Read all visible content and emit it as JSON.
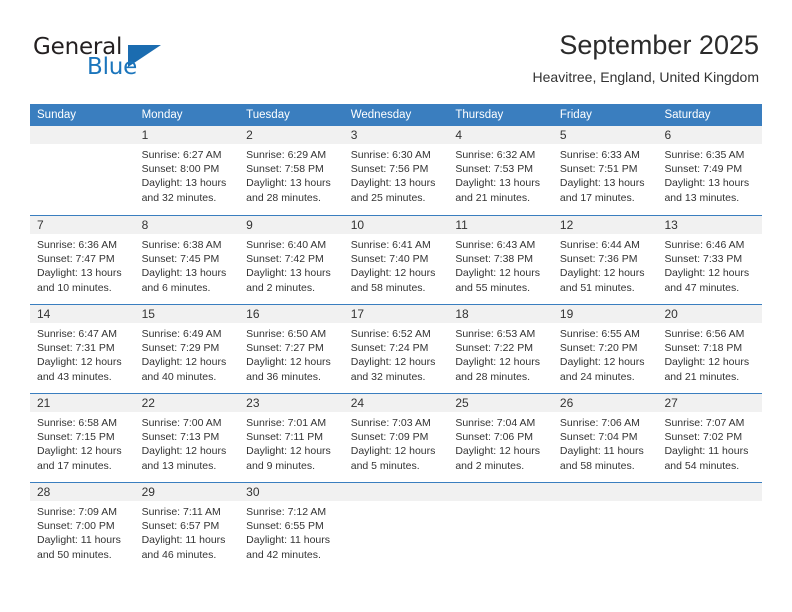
{
  "brand": {
    "name_part1": "General",
    "name_part2": "Blue"
  },
  "header": {
    "title": "September 2025",
    "subtitle": "Heavitree, England, United Kingdom"
  },
  "colors": {
    "header_blue": "#3a7ebf",
    "brand_blue": "#1b75bc",
    "day_band_gray": "#f1f1f1"
  },
  "weekdays": [
    "Sunday",
    "Monday",
    "Tuesday",
    "Wednesday",
    "Thursday",
    "Friday",
    "Saturday"
  ],
  "weeks": [
    [
      {
        "day": "",
        "sunrise": "",
        "sunset": "",
        "daylight_line1": "",
        "daylight_line2": "",
        "empty": true
      },
      {
        "day": "1",
        "sunrise": "Sunrise: 6:27 AM",
        "sunset": "Sunset: 8:00 PM",
        "daylight_line1": "Daylight: 13 hours",
        "daylight_line2": "and 32 minutes."
      },
      {
        "day": "2",
        "sunrise": "Sunrise: 6:29 AM",
        "sunset": "Sunset: 7:58 PM",
        "daylight_line1": "Daylight: 13 hours",
        "daylight_line2": "and 28 minutes."
      },
      {
        "day": "3",
        "sunrise": "Sunrise: 6:30 AM",
        "sunset": "Sunset: 7:56 PM",
        "daylight_line1": "Daylight: 13 hours",
        "daylight_line2": "and 25 minutes."
      },
      {
        "day": "4",
        "sunrise": "Sunrise: 6:32 AM",
        "sunset": "Sunset: 7:53 PM",
        "daylight_line1": "Daylight: 13 hours",
        "daylight_line2": "and 21 minutes."
      },
      {
        "day": "5",
        "sunrise": "Sunrise: 6:33 AM",
        "sunset": "Sunset: 7:51 PM",
        "daylight_line1": "Daylight: 13 hours",
        "daylight_line2": "and 17 minutes."
      },
      {
        "day": "6",
        "sunrise": "Sunrise: 6:35 AM",
        "sunset": "Sunset: 7:49 PM",
        "daylight_line1": "Daylight: 13 hours",
        "daylight_line2": "and 13 minutes."
      }
    ],
    [
      {
        "day": "7",
        "sunrise": "Sunrise: 6:36 AM",
        "sunset": "Sunset: 7:47 PM",
        "daylight_line1": "Daylight: 13 hours",
        "daylight_line2": "and 10 minutes."
      },
      {
        "day": "8",
        "sunrise": "Sunrise: 6:38 AM",
        "sunset": "Sunset: 7:45 PM",
        "daylight_line1": "Daylight: 13 hours",
        "daylight_line2": "and 6 minutes."
      },
      {
        "day": "9",
        "sunrise": "Sunrise: 6:40 AM",
        "sunset": "Sunset: 7:42 PM",
        "daylight_line1": "Daylight: 13 hours",
        "daylight_line2": "and 2 minutes."
      },
      {
        "day": "10",
        "sunrise": "Sunrise: 6:41 AM",
        "sunset": "Sunset: 7:40 PM",
        "daylight_line1": "Daylight: 12 hours",
        "daylight_line2": "and 58 minutes."
      },
      {
        "day": "11",
        "sunrise": "Sunrise: 6:43 AM",
        "sunset": "Sunset: 7:38 PM",
        "daylight_line1": "Daylight: 12 hours",
        "daylight_line2": "and 55 minutes."
      },
      {
        "day": "12",
        "sunrise": "Sunrise: 6:44 AM",
        "sunset": "Sunset: 7:36 PM",
        "daylight_line1": "Daylight: 12 hours",
        "daylight_line2": "and 51 minutes."
      },
      {
        "day": "13",
        "sunrise": "Sunrise: 6:46 AM",
        "sunset": "Sunset: 7:33 PM",
        "daylight_line1": "Daylight: 12 hours",
        "daylight_line2": "and 47 minutes."
      }
    ],
    [
      {
        "day": "14",
        "sunrise": "Sunrise: 6:47 AM",
        "sunset": "Sunset: 7:31 PM",
        "daylight_line1": "Daylight: 12 hours",
        "daylight_line2": "and 43 minutes."
      },
      {
        "day": "15",
        "sunrise": "Sunrise: 6:49 AM",
        "sunset": "Sunset: 7:29 PM",
        "daylight_line1": "Daylight: 12 hours",
        "daylight_line2": "and 40 minutes."
      },
      {
        "day": "16",
        "sunrise": "Sunrise: 6:50 AM",
        "sunset": "Sunset: 7:27 PM",
        "daylight_line1": "Daylight: 12 hours",
        "daylight_line2": "and 36 minutes."
      },
      {
        "day": "17",
        "sunrise": "Sunrise: 6:52 AM",
        "sunset": "Sunset: 7:24 PM",
        "daylight_line1": "Daylight: 12 hours",
        "daylight_line2": "and 32 minutes."
      },
      {
        "day": "18",
        "sunrise": "Sunrise: 6:53 AM",
        "sunset": "Sunset: 7:22 PM",
        "daylight_line1": "Daylight: 12 hours",
        "daylight_line2": "and 28 minutes."
      },
      {
        "day": "19",
        "sunrise": "Sunrise: 6:55 AM",
        "sunset": "Sunset: 7:20 PM",
        "daylight_line1": "Daylight: 12 hours",
        "daylight_line2": "and 24 minutes."
      },
      {
        "day": "20",
        "sunrise": "Sunrise: 6:56 AM",
        "sunset": "Sunset: 7:18 PM",
        "daylight_line1": "Daylight: 12 hours",
        "daylight_line2": "and 21 minutes."
      }
    ],
    [
      {
        "day": "21",
        "sunrise": "Sunrise: 6:58 AM",
        "sunset": "Sunset: 7:15 PM",
        "daylight_line1": "Daylight: 12 hours",
        "daylight_line2": "and 17 minutes."
      },
      {
        "day": "22",
        "sunrise": "Sunrise: 7:00 AM",
        "sunset": "Sunset: 7:13 PM",
        "daylight_line1": "Daylight: 12 hours",
        "daylight_line2": "and 13 minutes."
      },
      {
        "day": "23",
        "sunrise": "Sunrise: 7:01 AM",
        "sunset": "Sunset: 7:11 PM",
        "daylight_line1": "Daylight: 12 hours",
        "daylight_line2": "and 9 minutes."
      },
      {
        "day": "24",
        "sunrise": "Sunrise: 7:03 AM",
        "sunset": "Sunset: 7:09 PM",
        "daylight_line1": "Daylight: 12 hours",
        "daylight_line2": "and 5 minutes."
      },
      {
        "day": "25",
        "sunrise": "Sunrise: 7:04 AM",
        "sunset": "Sunset: 7:06 PM",
        "daylight_line1": "Daylight: 12 hours",
        "daylight_line2": "and 2 minutes."
      },
      {
        "day": "26",
        "sunrise": "Sunrise: 7:06 AM",
        "sunset": "Sunset: 7:04 PM",
        "daylight_line1": "Daylight: 11 hours",
        "daylight_line2": "and 58 minutes."
      },
      {
        "day": "27",
        "sunrise": "Sunrise: 7:07 AM",
        "sunset": "Sunset: 7:02 PM",
        "daylight_line1": "Daylight: 11 hours",
        "daylight_line2": "and 54 minutes."
      }
    ],
    [
      {
        "day": "28",
        "sunrise": "Sunrise: 7:09 AM",
        "sunset": "Sunset: 7:00 PM",
        "daylight_line1": "Daylight: 11 hours",
        "daylight_line2": "and 50 minutes."
      },
      {
        "day": "29",
        "sunrise": "Sunrise: 7:11 AM",
        "sunset": "Sunset: 6:57 PM",
        "daylight_line1": "Daylight: 11 hours",
        "daylight_line2": "and 46 minutes."
      },
      {
        "day": "30",
        "sunrise": "Sunrise: 7:12 AM",
        "sunset": "Sunset: 6:55 PM",
        "daylight_line1": "Daylight: 11 hours",
        "daylight_line2": "and 42 minutes."
      },
      {
        "day": "",
        "sunrise": "",
        "sunset": "",
        "daylight_line1": "",
        "daylight_line2": "",
        "empty": true
      },
      {
        "day": "",
        "sunrise": "",
        "sunset": "",
        "daylight_line1": "",
        "daylight_line2": "",
        "empty": true
      },
      {
        "day": "",
        "sunrise": "",
        "sunset": "",
        "daylight_line1": "",
        "daylight_line2": "",
        "empty": true
      },
      {
        "day": "",
        "sunrise": "",
        "sunset": "",
        "daylight_line1": "",
        "daylight_line2": "",
        "empty": true
      }
    ]
  ]
}
